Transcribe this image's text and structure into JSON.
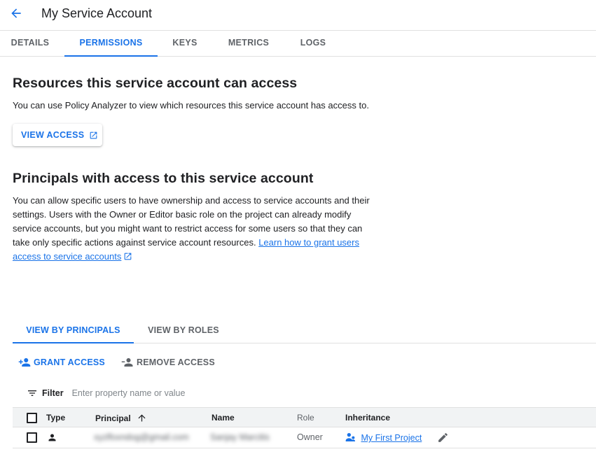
{
  "header": {
    "title": "My Service Account"
  },
  "tabs": [
    {
      "label": "DETAILS"
    },
    {
      "label": "PERMISSIONS"
    },
    {
      "label": "KEYS"
    },
    {
      "label": "METRICS"
    },
    {
      "label": "LOGS"
    }
  ],
  "active_tab": "PERMISSIONS",
  "resources": {
    "heading": "Resources this service account can access",
    "description": "You can use Policy Analyzer to view which resources this service account has access to.",
    "view_access_label": "VIEW ACCESS"
  },
  "principals": {
    "heading": "Principals with access to this service account",
    "description": "You can allow specific users to have ownership and access to service accounts and their settings. Users with the Owner or Editor basic role on the project can already modify service accounts, but you might want to restrict access for some users so that they can take only specific actions against service account resources.",
    "learn_link": "Learn how to grant users access to service accounts"
  },
  "view_tabs": [
    {
      "label": "VIEW BY PRINCIPALS"
    },
    {
      "label": "VIEW BY ROLES"
    }
  ],
  "actions": {
    "grant_label": "GRANT ACCESS",
    "remove_label": "REMOVE ACCESS"
  },
  "filter": {
    "label": "Filter",
    "placeholder": "Enter property name or value"
  },
  "table": {
    "columns": {
      "type": "Type",
      "principal": "Principal",
      "name": "Name",
      "role": "Role",
      "inheritance": "Inheritance"
    },
    "rows": [
      {
        "principal": "xyzlfoxndog@gmail.com",
        "name": "Sanjay Marcitis",
        "role": "Owner",
        "inheritance": "My First Project"
      }
    ]
  },
  "colors": {
    "accent": "#1a73e8",
    "text": "#202124",
    "muted": "#5f6368",
    "header_bg": "#f1f3f4"
  }
}
